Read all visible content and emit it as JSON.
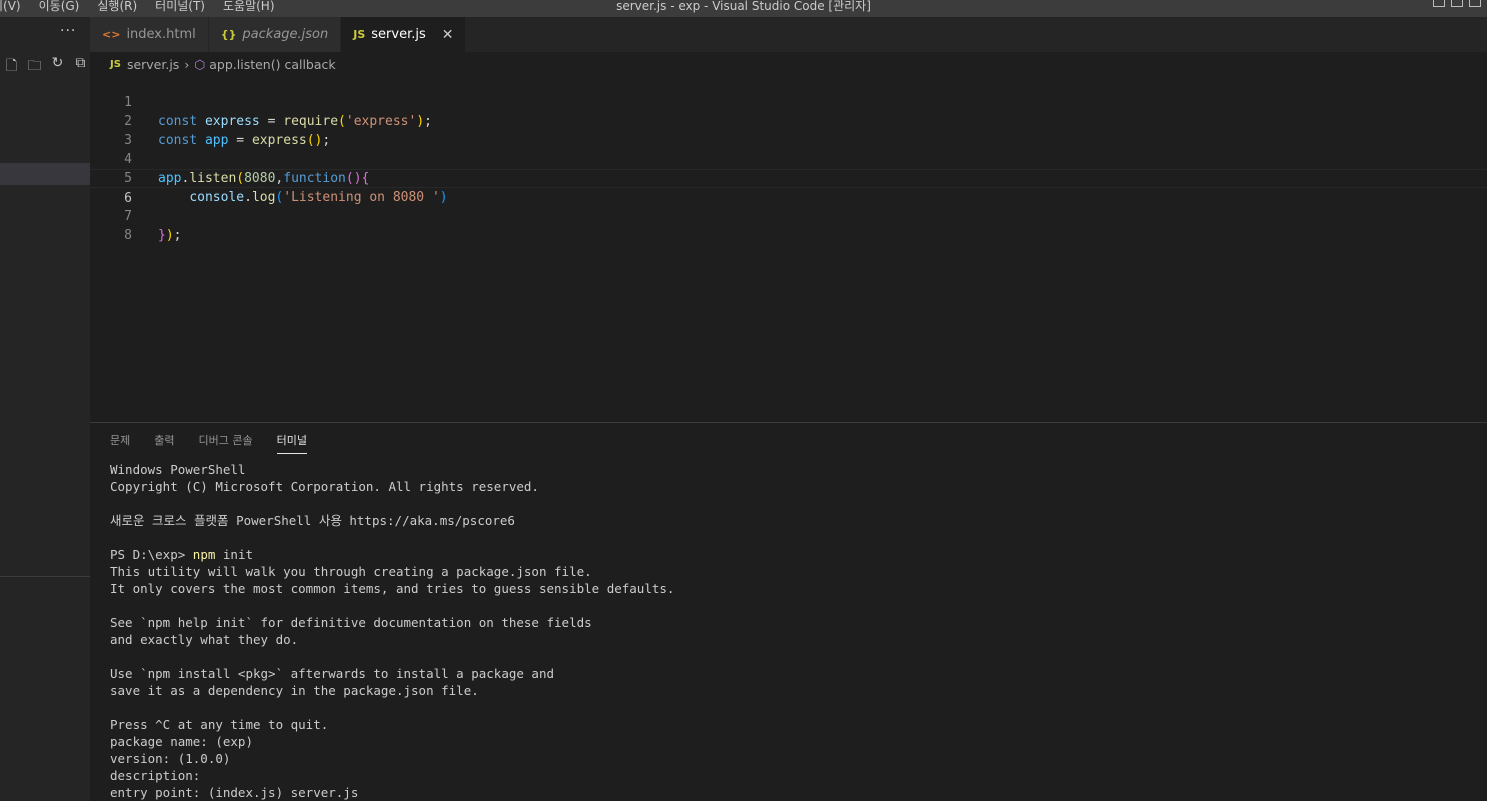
{
  "titlebar": {
    "menu": [
      "기(V)",
      "이동(G)",
      "실행(R)",
      "터미널(T)",
      "도움말(H)"
    ],
    "title": "server.js - exp - Visual Studio Code [관리자]"
  },
  "sidebar": {
    "more_label": "···",
    "actions": [
      "new-file-icon",
      "new-folder-icon",
      "refresh-icon",
      "collapse-all-icon"
    ]
  },
  "tabs": [
    {
      "icon": "<>",
      "label": "index.html",
      "italic": false
    },
    {
      "icon": "{}",
      "label": "package.json",
      "italic": true
    },
    {
      "icon": "JS",
      "label": "server.js",
      "active": true,
      "close": "✕"
    }
  ],
  "breadcrumb": {
    "file_icon": "JS",
    "file": "server.js",
    "symbol": "app.listen() callback"
  },
  "editor": {
    "line_numbers": [
      "1",
      "2",
      "3",
      "4",
      "5",
      "6",
      "7",
      "8"
    ],
    "l1": {
      "kw": "const",
      "var": "express",
      "op": " = ",
      "fn": "require",
      "p_open": "(",
      "str": "'express'",
      "p_close": ")",
      "end": ";"
    },
    "l2": {
      "kw": "const",
      "var": "app",
      "op": " = ",
      "fn": "express",
      "parens": "()",
      "end": ";"
    },
    "l4": {
      "var": "app",
      "dot": ".",
      "fn": "listen",
      "p_open": "(",
      "num": "8080",
      "comma": ",",
      "kw": "function",
      "p2": "()",
      "brace": "{"
    },
    "l5": {
      "indent": "    ",
      "var": "console",
      "dot": ".",
      "fn": "log",
      "p_open": "(",
      "str": "'Listening on 8080 '",
      "p_close": ")"
    },
    "l7": {
      "brace": "}",
      "p_close": ")",
      "end": ";"
    }
  },
  "panel": {
    "tabs": [
      "문제",
      "출력",
      "디버그 콘솔",
      "터미널"
    ],
    "active_tab": "터미널"
  },
  "terminal": {
    "lines": [
      "Windows PowerShell",
      "Copyright (C) Microsoft Corporation. All rights reserved.",
      "",
      "새로운 크로스 플랫폼 PowerShell 사용 https://aka.ms/pscore6",
      "",
      "__PROMPT__",
      "This utility will walk you through creating a package.json file.",
      "It only covers the most common items, and tries to guess sensible defaults.",
      "",
      "See `npm help init` for definitive documentation on these fields",
      "and exactly what they do.",
      "",
      "Use `npm install <pkg>` afterwards to install a package and",
      "save it as a dependency in the package.json file.",
      "",
      "Press ^C at any time to quit.",
      "package name: (exp)",
      "version: (1.0.0)",
      "description:",
      "entry point: (index.js) server.js"
    ],
    "prompt": "PS D:\\exp> ",
    "prompt_cmd": "npm",
    "prompt_arg": " init"
  }
}
